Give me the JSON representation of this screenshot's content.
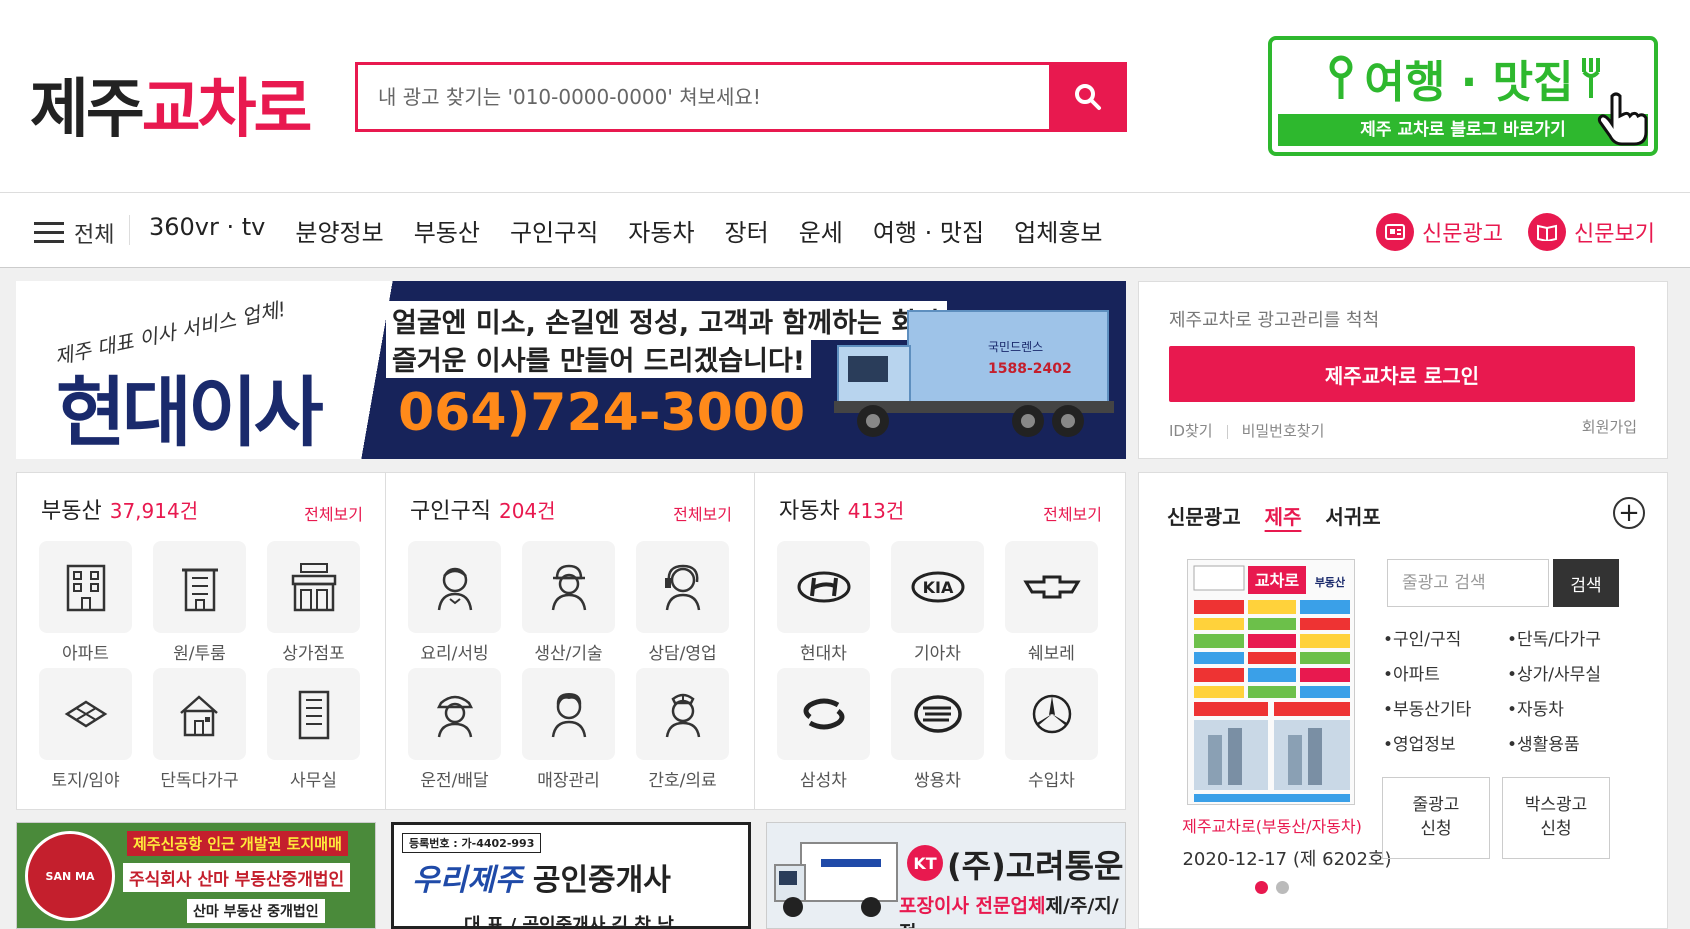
{
  "header": {
    "logo_part1": "제주",
    "logo_part2": "교차로",
    "search_placeholder": "내 광고 찾기는 '010-0000-0000' 쳐보세요!",
    "travel_title": "여행 · 맛집",
    "travel_sub": "제주 교차로 블로그 바로가기"
  },
  "nav": {
    "all_label": "전체",
    "items": [
      "360vr · tv",
      "분양정보",
      "부동산",
      "구인구직",
      "자동차",
      "장터",
      "운세",
      "여행 · 맛집",
      "업체홍보"
    ],
    "news_ad": "신문광고",
    "news_view": "신문보기"
  },
  "ad_banner": {
    "slogan": "제주 대표 이사 서비스 업체!",
    "company": "현대이사",
    "line1": "얼굴엔 미소, 손길엔 정성, 고객과 함께하는 회사",
    "line2": "즐거운 이사를 만들어 드리겠습니다!",
    "phone": "064)724-3000",
    "truck_text": "국민드렌스",
    "truck_phone": "1588-2402"
  },
  "login": {
    "guide": "제주교차로 광고관리를 척척",
    "button": "제주교차로 로그인",
    "find_id": "ID찾기",
    "find_pw": "비밀번호찾기",
    "join": "회원가입"
  },
  "categories": [
    {
      "title": "부동산",
      "count": "37,914건",
      "more": "전체보기",
      "items": [
        {
          "label": "아파트",
          "icon": "apartment-icon"
        },
        {
          "label": "원/투룸",
          "icon": "building-icon"
        },
        {
          "label": "상가점포",
          "icon": "market-icon"
        },
        {
          "label": "토지/임야",
          "icon": "land-icon"
        },
        {
          "label": "단독다가구",
          "icon": "house-icon"
        },
        {
          "label": "사무실",
          "icon": "office-icon"
        }
      ]
    },
    {
      "title": "구인구직",
      "count": "204건",
      "more": "전체보기",
      "items": [
        {
          "label": "요리/서빙",
          "icon": "waiter-icon"
        },
        {
          "label": "생산/기술",
          "icon": "worker-icon"
        },
        {
          "label": "상담/영업",
          "icon": "operator-icon"
        },
        {
          "label": "운전/배달",
          "icon": "driver-icon"
        },
        {
          "label": "매장관리",
          "icon": "clerk-icon"
        },
        {
          "label": "간호/의료",
          "icon": "nurse-icon"
        }
      ]
    },
    {
      "title": "자동차",
      "count": "413건",
      "more": "전체보기",
      "items": [
        {
          "label": "현대차",
          "icon": "hyundai-icon"
        },
        {
          "label": "기아차",
          "icon": "kia-icon"
        },
        {
          "label": "쉐보레",
          "icon": "chevrolet-icon"
        },
        {
          "label": "삼성차",
          "icon": "samsung-icon"
        },
        {
          "label": "쌍용차",
          "icon": "ssangyong-icon"
        },
        {
          "label": "수입차",
          "icon": "benz-icon"
        }
      ]
    }
  ],
  "paper": {
    "tabs": [
      "신문광고",
      "제주",
      "서귀포"
    ],
    "active_tab": "제주",
    "thumb_title": "교차로",
    "thumb_sub": "부동산",
    "caption": "제주교차로(부동산/자동차)",
    "date": "2020-12-17 (제 6202호)",
    "search_placeholder": "줄광고 검색",
    "search_button": "검색",
    "links": [
      "•구인/구직",
      "•단독/다가구",
      "•아파트",
      "•상가/사무실",
      "•부동산기타",
      "•자동차",
      "•영업정보",
      "•생활용품"
    ],
    "apply_line": [
      "줄광고",
      "신청"
    ],
    "apply_box": [
      "박스광고",
      "신청"
    ]
  },
  "bottom_ads": {
    "ad1_seal": "SAN MA",
    "ad1_line1": "제주신공항 인근 개발권 토지매매",
    "ad1_line2": "주식회사 산마 부동산중개법인",
    "ad1_line3": "산마 부동산 중개법인",
    "ad2_reg": "등록번호 : 가-4402-993",
    "ad2_name_a": "우리제주",
    "ad2_name_b": " 공인중개사",
    "ad2_rep": "대 표 / 공인중개사 김 창 남",
    "ad3_kt": "KT",
    "ad3_name": "(주)고려통운",
    "ad3_sub_a": "포장이사 전문업체",
    "ad3_sub_b": "제/주/지/점"
  },
  "colors": {
    "accent": "#e8194f",
    "travel_green": "#2eb82e",
    "navy": "#17235a",
    "phone_orange": "#ff8a1a"
  }
}
